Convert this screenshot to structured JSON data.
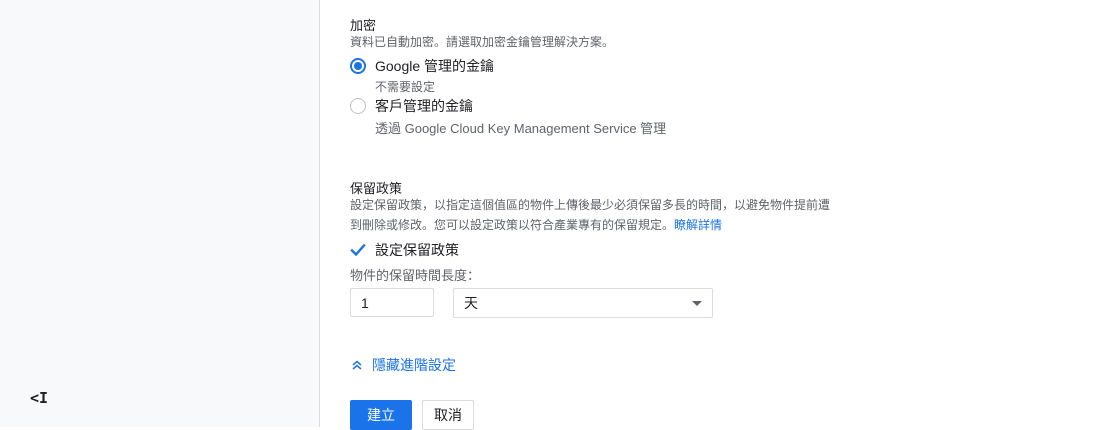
{
  "sidebar": {
    "collapse_icon": "collapse-left-icon",
    "collapse_glyph": "<I"
  },
  "encryption": {
    "title": "加密",
    "description": "資料已自動加密。請選取加密金鑰管理解決方案。",
    "options": [
      {
        "label": "Google 管理的金鑰",
        "sublabel": "不需要設定",
        "selected": true
      },
      {
        "label": "客戶管理的金鑰",
        "sublabel": "透過 Google Cloud Key Management Service 管理",
        "selected": false
      }
    ]
  },
  "retention": {
    "title": "保留政策",
    "description_line1": "設定保留政策，以指定這個值區的物件上傳後最少必須保留多長的時間，以避免物件提前遭",
    "description_line2": "到刪除或修改。您可以設定政策以符合產業專有的保留規定。",
    "learn_more": "瞭解詳情",
    "checkbox_label": "設定保留政策",
    "checkbox_checked": true,
    "duration_label": "物件的保留時間長度：",
    "duration_value": "1",
    "unit_selected": "天"
  },
  "advanced_toggle": {
    "label": "隱藏進階設定",
    "icon": "chevron-double-up-icon"
  },
  "actions": {
    "create_label": "建立",
    "cancel_label": "取消"
  },
  "colors": {
    "accent": "#1a73e8",
    "text": "#202124",
    "muted": "#5f6368",
    "border": "#dadce0",
    "sidebar_bg": "#f8f9fa"
  }
}
